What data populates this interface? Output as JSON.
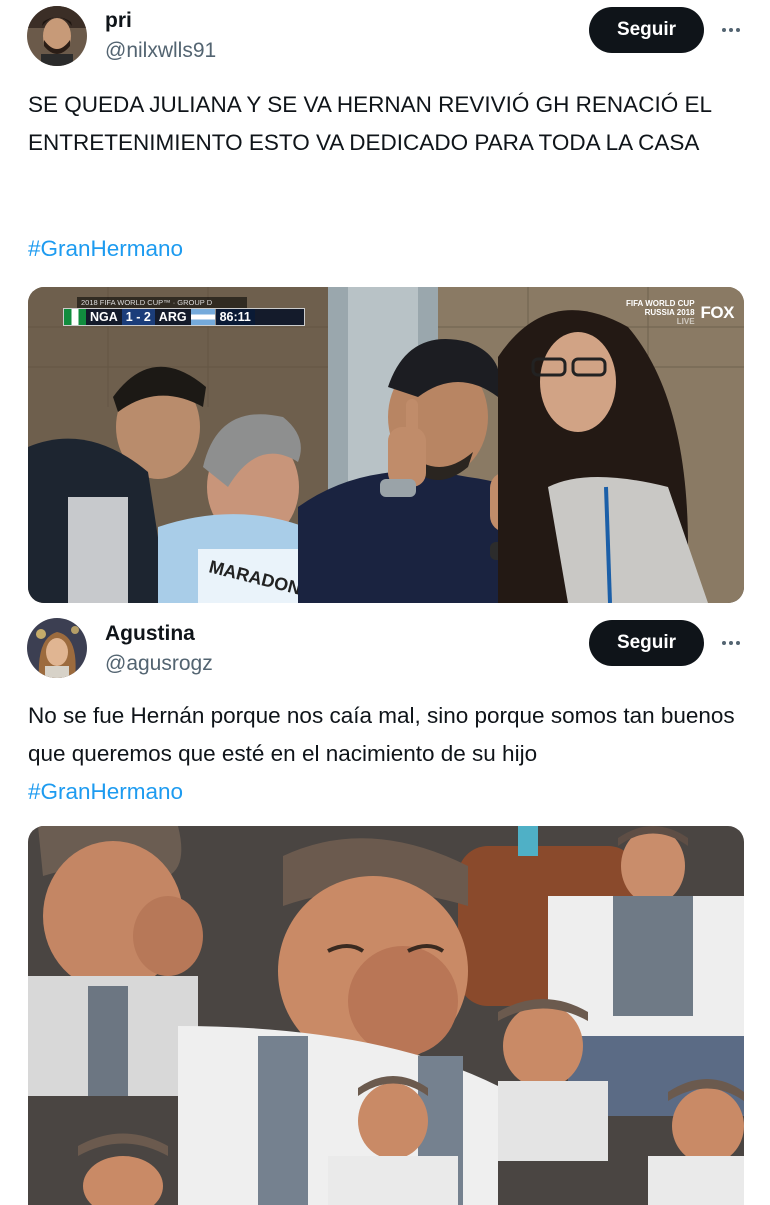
{
  "tweets": [
    {
      "name": "pri",
      "handle": "@nilxwlls91",
      "follow_label": "Seguir",
      "text": "SE QUEDA JULIANA Y SE VA HERNAN REVIVIÓ GH RENACIÓ EL ENTRETENIMIENTO ESTO VA DEDICADO PARA TODA LA CASA",
      "hashtag": "#GranHermano",
      "media": {
        "scoreboard": {
          "header": "2018 FIFA WORLD CUP™ · GROUP D",
          "team_home": "NGA",
          "score": "1 - 2",
          "team_away": "ARG",
          "clock": "86:11"
        },
        "broadcast": {
          "event_line1": "FIFA WORLD CUP",
          "event_line2": "RUSSIA 2018",
          "network": "FOX",
          "live": "LIVE"
        }
      }
    },
    {
      "name": "Agustina",
      "handle": "@agusrogz",
      "follow_label": "Seguir",
      "text": "No se fue Hernán porque nos caía mal, sino porque somos tan buenos que queremos que esté en el nacimiento de su hijo",
      "hashtag": "#GranHermano"
    }
  ],
  "icons": {
    "more": "more-horizontal-icon"
  },
  "colors": {
    "text": "#0f1419",
    "secondary": "#536471",
    "link": "#1d9bf0",
    "button_bg": "#0f1419",
    "button_text": "#ffffff"
  }
}
